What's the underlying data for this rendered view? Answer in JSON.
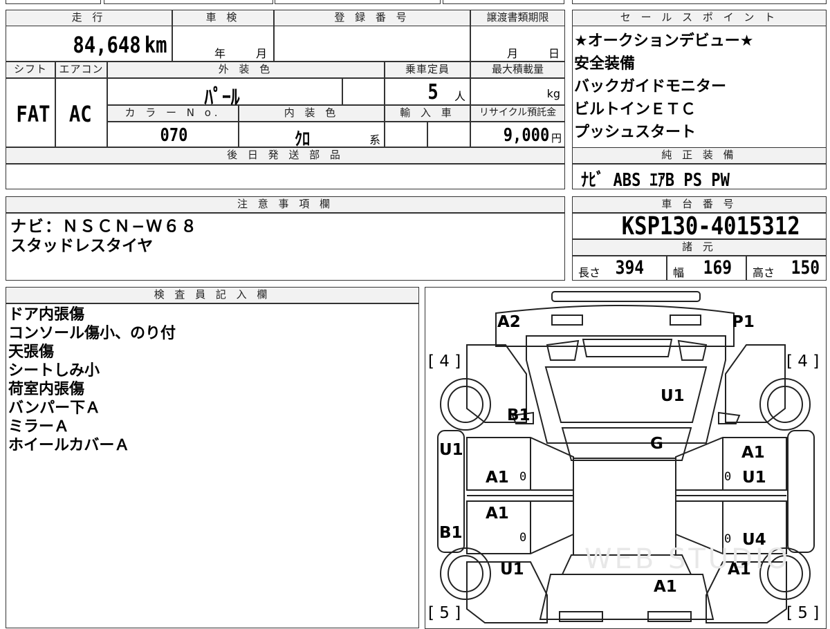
{
  "header": {
    "mileage_label": "走 行",
    "mileage_value": "84,648",
    "mileage_unit": "km",
    "inspection_label": "車 検",
    "inspection_year": "年",
    "inspection_month": "月",
    "registration_label": "登 録 番 号",
    "transfer_label": "譲渡書類期限",
    "transfer_month": "月",
    "transfer_day": "日"
  },
  "row2": {
    "shift_label": "シフト",
    "shift_value": "FAT",
    "ac_label": "エアコン",
    "ac_value": "AC",
    "exterior_label": "外 装 色",
    "exterior_value": "ﾊﾟｰﾙ",
    "capacity_label": "乗車定員",
    "capacity_value": "5",
    "capacity_unit": "人",
    "maxload_label": "最大積載量",
    "maxload_unit": "kg",
    "color_no_label": "カ ラ ー N o.",
    "color_no_value": "070",
    "interior_label": "内 装 色",
    "interior_value": "ｸﾛ",
    "interior_suffix": "系",
    "import_label": "輸 入 車",
    "recycle_label": "リサイクル預託金",
    "recycle_value": "9,000",
    "recycle_unit": "円"
  },
  "later_parts_label": "後 日 発 送 部 品",
  "sales_points": {
    "label": "セ ー ル ス ポ イ ン ト",
    "items": [
      "★オークションデビュー★",
      "安全装備",
      "バックガイドモニター",
      "ビルトインＥＴＣ",
      "プッシュスタート"
    ]
  },
  "genuine_equipment": {
    "label": "純 正 装 備",
    "value": "ﾅﾋﾞ ABS ｴｱB PS PW"
  },
  "notes": {
    "label": "注 意 事 項 欄",
    "lines": [
      "ナビ：ＮＳＣＮ−Ｗ６８",
      "スタッドレスタイヤ"
    ]
  },
  "chassis": {
    "label": "車 台 番 号",
    "value": "KSP130-4015312"
  },
  "specs": {
    "label": "諸 元",
    "length_label": "長さ",
    "length_value": "394",
    "width_label": "幅",
    "width_value": "169",
    "height_label": "高さ",
    "height_value": "150"
  },
  "inspector": {
    "label": "検 査 員 記 入 欄",
    "lines": [
      "ドア内張傷",
      "コンソール傷小、のり付",
      "天張傷",
      "シートしみ小",
      "荷室内張傷",
      "バンパー下Ａ",
      "ミラーＡ",
      "ホイールカバーＡ"
    ]
  },
  "diagram": {
    "watermark": "WEB STUDIO",
    "labels": {
      "a2": "A2",
      "p1": "P1",
      "tire_fl": "[ 4 ]",
      "tire_fr": "[ 4 ]",
      "tire_rl": "[ 5 ]",
      "tire_rr": "[ 5 ]",
      "u1_roof": "U1",
      "b1_pillar": "B1",
      "g_glass": "G",
      "u1_left_front": "U1",
      "a1_left_front_door": "A1",
      "a1_left_rear_door": "A1",
      "b1_left": "B1",
      "u1_left_rear": "U1",
      "a1_right_front": "A1",
      "u1_right_front_door": "U1",
      "u4_right_rear_door": "U4",
      "a1_right_rear": "A1",
      "a1_rear": "A1",
      "zero_1": "0",
      "zero_2": "0",
      "zero_3": "0",
      "zero_4": "0"
    }
  }
}
